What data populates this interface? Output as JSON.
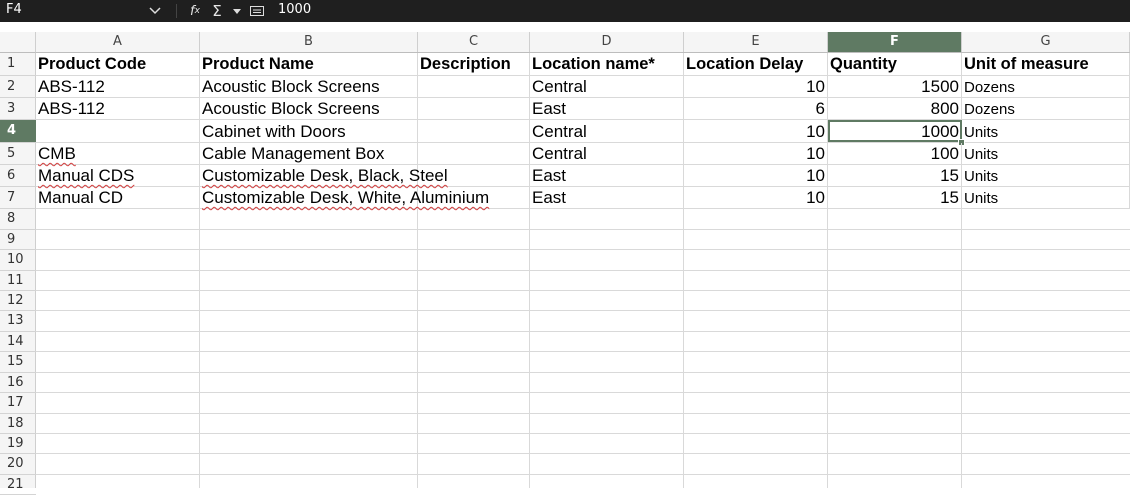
{
  "formula_bar": {
    "cell_ref": "F4",
    "value": "1000",
    "icons": [
      "chevron-down-icon",
      "function-icon",
      "sum-icon",
      "caret-down-icon",
      "equals-icon"
    ]
  },
  "columns": [
    "A",
    "B",
    "C",
    "D",
    "E",
    "F",
    "G"
  ],
  "selected_column": "F",
  "rows": [
    "1",
    "2",
    "3",
    "4",
    "5",
    "6",
    "7",
    "8",
    "9",
    "10",
    "11",
    "12",
    "13",
    "14",
    "15",
    "16",
    "17",
    "18",
    "19",
    "20",
    "21"
  ],
  "selected_row": "4",
  "headers": {
    "a": "Product Code",
    "b": "Product Name",
    "c": "Description",
    "d": "Location name*",
    "e": "Location Delay",
    "f": "Quantity",
    "g": "Unit of measure"
  },
  "data_rows": [
    {
      "a": "ABS-112",
      "b": "Acoustic Block Screens",
      "c": "",
      "d": "Central",
      "e": "10",
      "f": "1500",
      "g": "Dozens"
    },
    {
      "a": "ABS-112",
      "b": "Acoustic Block Screens",
      "c": "",
      "d": "East",
      "e": "6",
      "f": "800",
      "g": "Dozens"
    },
    {
      "a": "",
      "b": "Cabinet with Doors",
      "c": "",
      "d": "Central",
      "e": "10",
      "f": "1000",
      "g": "Units"
    },
    {
      "a": "CMB",
      "b": "Cable Management Box",
      "c": "",
      "d": "Central",
      "e": "10",
      "f": "100",
      "g": "Units"
    },
    {
      "a": "Manual CDS",
      "b": "Customizable Desk, Black, Steel",
      "c": "",
      "d": "East",
      "e": "10",
      "f": "15",
      "g": "Units"
    },
    {
      "a": "Manual CD",
      "b": "Customizable Desk, White, Aluminium",
      "c": "",
      "d": "East",
      "e": "10",
      "f": "15",
      "g": "Units"
    }
  ],
  "colors": {
    "selection": "#5f7a63",
    "spellcheck": "#d33b3b",
    "toolbar": "#1f1f1f"
  }
}
